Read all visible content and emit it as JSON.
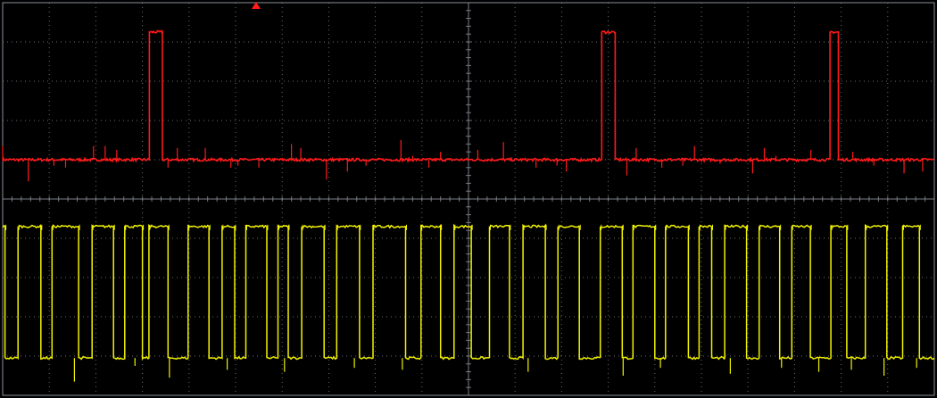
{
  "chart_data": {
    "type": "line",
    "title": "",
    "xlabel": "",
    "ylabel": "",
    "grid": true,
    "trigger_marker": {
      "color": "#ff1a1a",
      "x": 5.44
    },
    "grid_divisions": {
      "x": 20,
      "y": 10
    },
    "colors": {
      "background": "#000000",
      "grid": "#8a8f99",
      "ch1": "#f2f200",
      "ch2": "#ff1a1a"
    },
    "series": [
      {
        "channel": "ch2",
        "baseline_div": 6.0,
        "high_div": 9.25,
        "pulses": [
          {
            "start": 3.15,
            "end": 3.43
          },
          {
            "start": 12.86,
            "end": 13.15
          },
          {
            "start": 17.76,
            "end": 17.94
          }
        ],
        "spikes": [
          [
            0.0,
            6.35
          ],
          [
            0.55,
            5.45
          ],
          [
            1.1,
            5.85
          ],
          [
            1.35,
            5.8
          ],
          [
            1.95,
            6.35
          ],
          [
            2.2,
            6.35
          ],
          [
            2.45,
            6.25
          ],
          [
            3.55,
            5.8
          ],
          [
            3.75,
            6.3
          ],
          [
            4.35,
            6.3
          ],
          [
            4.9,
            5.8
          ],
          [
            5.05,
            5.85
          ],
          [
            5.5,
            5.8
          ],
          [
            6.2,
            6.4
          ],
          [
            6.4,
            6.3
          ],
          [
            6.95,
            5.5
          ],
          [
            7.4,
            5.7
          ],
          [
            7.8,
            5.85
          ],
          [
            8.55,
            6.5
          ],
          [
            8.8,
            6.1
          ],
          [
            9.15,
            5.8
          ],
          [
            9.4,
            6.2
          ],
          [
            10.2,
            6.25
          ],
          [
            10.75,
            6.45
          ],
          [
            11.45,
            5.8
          ],
          [
            11.9,
            5.85
          ],
          [
            12.1,
            5.7
          ],
          [
            13.4,
            5.6
          ],
          [
            13.6,
            6.3
          ],
          [
            14.15,
            5.8
          ],
          [
            14.6,
            5.85
          ],
          [
            14.85,
            6.35
          ],
          [
            15.4,
            5.9
          ],
          [
            16.1,
            5.65
          ],
          [
            16.35,
            6.3
          ],
          [
            16.6,
            6.1
          ],
          [
            17.35,
            6.25
          ],
          [
            18.25,
            6.2
          ],
          [
            18.7,
            5.85
          ],
          [
            19.35,
            5.65
          ],
          [
            19.75,
            5.7
          ]
        ]
      },
      {
        "channel": "ch1",
        "low_div": 0.95,
        "high_div": 4.3,
        "edges": [
          0.05,
          0.33,
          0.82,
          1.06,
          1.63,
          1.92,
          2.38,
          2.62,
          3.0,
          3.14,
          3.55,
          3.98,
          4.43,
          4.71,
          4.98,
          5.22,
          5.67,
          5.91,
          6.13,
          6.42,
          6.9,
          7.17,
          7.66,
          7.95,
          8.65,
          8.98,
          9.4,
          9.69,
          10.06,
          10.45,
          10.88,
          11.17,
          11.65,
          11.92,
          12.38,
          12.83,
          13.3,
          13.53,
          14.0,
          14.23,
          14.72,
          14.95,
          15.22,
          15.5,
          15.97,
          16.24,
          16.68,
          16.94,
          17.34,
          17.78,
          18.12,
          18.52,
          18.98,
          19.32,
          19.68
        ],
        "spikes": [
          [
            1.54,
            0.35
          ],
          [
            2.84,
            0.75
          ],
          [
            3.58,
            0.45
          ],
          [
            4.82,
            0.65
          ],
          [
            6.05,
            0.6
          ],
          [
            7.55,
            0.7
          ],
          [
            8.58,
            0.65
          ],
          [
            11.28,
            0.6
          ],
          [
            13.32,
            0.5
          ],
          [
            14.12,
            0.7
          ],
          [
            15.62,
            0.55
          ],
          [
            16.72,
            0.7
          ],
          [
            17.52,
            0.6
          ],
          [
            18.22,
            0.65
          ],
          [
            18.92,
            0.5
          ],
          [
            19.62,
            0.7
          ]
        ]
      }
    ]
  }
}
